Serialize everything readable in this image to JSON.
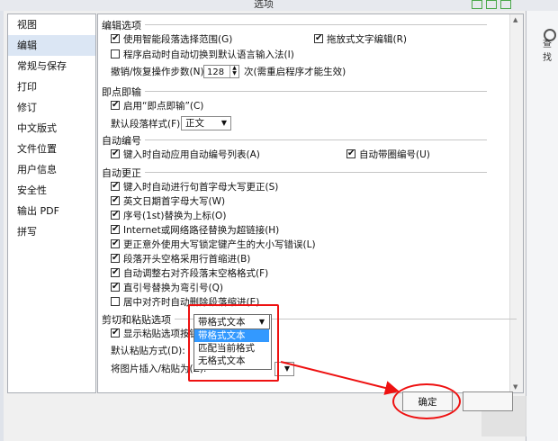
{
  "window": {
    "title": "选项"
  },
  "toolbar": {
    "find_label": "查找"
  },
  "sidebar": {
    "items": [
      {
        "label": "视图"
      },
      {
        "label": "编辑"
      },
      {
        "label": "常规与保存"
      },
      {
        "label": "打印"
      },
      {
        "label": "修订"
      },
      {
        "label": "中文版式"
      },
      {
        "label": "文件位置"
      },
      {
        "label": "用户信息"
      },
      {
        "label": "安全性"
      },
      {
        "label": "输出 PDF"
      },
      {
        "label": "拼写"
      }
    ],
    "selected": 1
  },
  "edit_options": {
    "title": "编辑选项",
    "smart_select": "使用智能段落选择范围(G)",
    "drag_drop": "拖放式文字编辑(R)",
    "auto_ime": "程序启动时自动切换到默认语言输入法(I)",
    "undo_label": "撤销/恢复操作步数(N):",
    "undo_value": "128",
    "undo_suffix": "次(需重启程序才能生效)"
  },
  "click_type": {
    "title": "即点即输",
    "enable": "启用“即点即输”(C)",
    "default_style_label": "默认段落样式(F):",
    "default_style_value": "正文"
  },
  "auto_number": {
    "title": "自动编号",
    "auto_list": "键入时自动应用自动编号列表(A)",
    "circle_num": "自动带圈编号(U)"
  },
  "auto_correct": {
    "title": "自动更正",
    "items": [
      {
        "label": "键入时自动进行句首字母大写更正(S)",
        "checked": true
      },
      {
        "label": "英文日期首字母大写(W)",
        "checked": true
      },
      {
        "label": "序号(1st)替换为上标(O)",
        "checked": true
      },
      {
        "label": "Internet或网络路径替换为超链接(H)",
        "checked": true
      },
      {
        "label": "更正意外使用大写锁定键产生的大小写错误(L)",
        "checked": true
      },
      {
        "label": "段落开头空格采用行首缩进(B)",
        "checked": true
      },
      {
        "label": "自动调整右对齐段落末空格格式(F)",
        "checked": true
      },
      {
        "label": "直引号替换为弯引号(Q)",
        "checked": true
      },
      {
        "label": "居中对齐时自动删除段落缩进(E)",
        "checked": false
      }
    ]
  },
  "paste": {
    "title": "剪切和粘贴选项",
    "show_btn": "显示粘贴选项按钮(P)",
    "default_label": "默认粘贴方式(D):",
    "default_value": "带格式文本",
    "insert_label": "将图片插入/粘贴为(Z):",
    "options": [
      "带格式文本",
      "匹配当前格式",
      "无格式文本"
    ]
  },
  "buttons": {
    "ok": "确定"
  },
  "colors": {
    "highlight": "#3399ff",
    "annotation": "#ee1111"
  }
}
